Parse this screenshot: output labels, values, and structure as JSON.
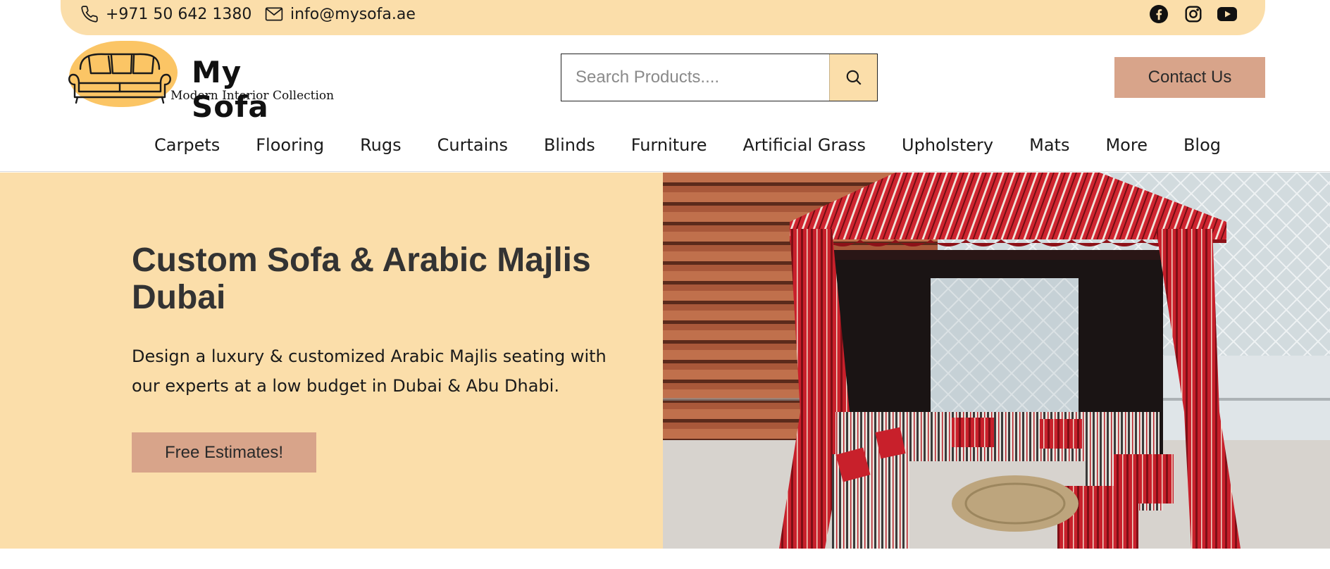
{
  "topbar": {
    "phone": "+971 50 642 1380",
    "email": "info@mysofa.ae",
    "social_icons": [
      "facebook-icon",
      "instagram-icon",
      "youtube-icon"
    ]
  },
  "header": {
    "logo_name": "My Sofa",
    "logo_tagline": "Modern  Interior Collection",
    "search_placeholder": "Search Products....",
    "contact_button": "Contact Us"
  },
  "nav": {
    "items": [
      "Carpets",
      "Flooring",
      "Rugs",
      "Curtains",
      "Blinds",
      "Furniture",
      "Artificial Grass",
      "Upholstery",
      "Mats",
      "More",
      "Blog"
    ]
  },
  "hero": {
    "title": "Custom Sofa & Arabic Majlis Dubai",
    "description": "Design a luxury & customized Arabic Majlis seating with our experts at a low budget in Dubai & Abu Dhabi.",
    "cta": "Free Estimates!"
  },
  "colors": {
    "topbar_bg": "#fbdeaa",
    "hero_bg": "#fbdeaa",
    "button_bg": "#d8a48a",
    "logo_accent": "#fbc565",
    "majlis_red": "#c8202b"
  }
}
